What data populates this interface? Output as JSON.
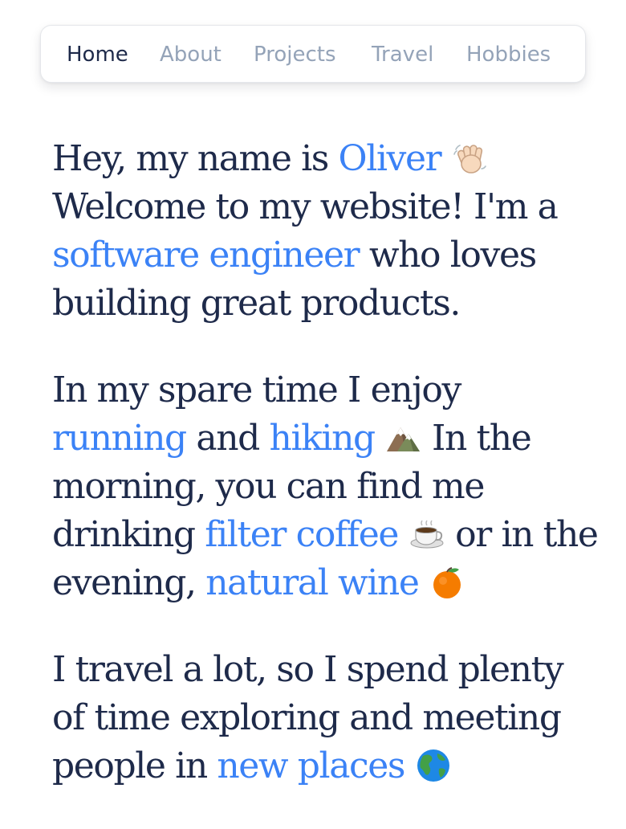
{
  "nav": {
    "items": [
      {
        "label": "Home",
        "active": true
      },
      {
        "label": "About",
        "active": false
      },
      {
        "label": "Projects",
        "active": false
      },
      {
        "label": "Travel",
        "active": false
      },
      {
        "label": "Hobbies",
        "active": false
      }
    ]
  },
  "intro": {
    "p1_a": "Hey, my name is ",
    "p1_name": "Oliver",
    "p1_b": " Welcome to my website! I'm a ",
    "p1_link": "software engineer",
    "p1_c": " who loves building great products.",
    "p2_a": "In my spare time I enjoy ",
    "p2_running": "running",
    "p2_b": " and ",
    "p2_hiking": "hiking",
    "p2_c": " In the morning, you can find me drinking ",
    "p2_coffee": "filter coffee",
    "p2_d": " or in the evening, ",
    "p2_wine": "natural wine",
    "p3_a": "I travel a lot, so I spend plenty of time exploring and meeting people in ",
    "p3_places": "new places"
  },
  "icons": {
    "wave": "waving-hand-icon",
    "mountain": "mountain-icon",
    "coffee": "coffee-icon",
    "orange": "orange-icon",
    "globe": "globe-icon"
  },
  "colors": {
    "text": "#1e2a4a",
    "link": "#3b82f6",
    "nav_inactive": "#94a3b8"
  }
}
